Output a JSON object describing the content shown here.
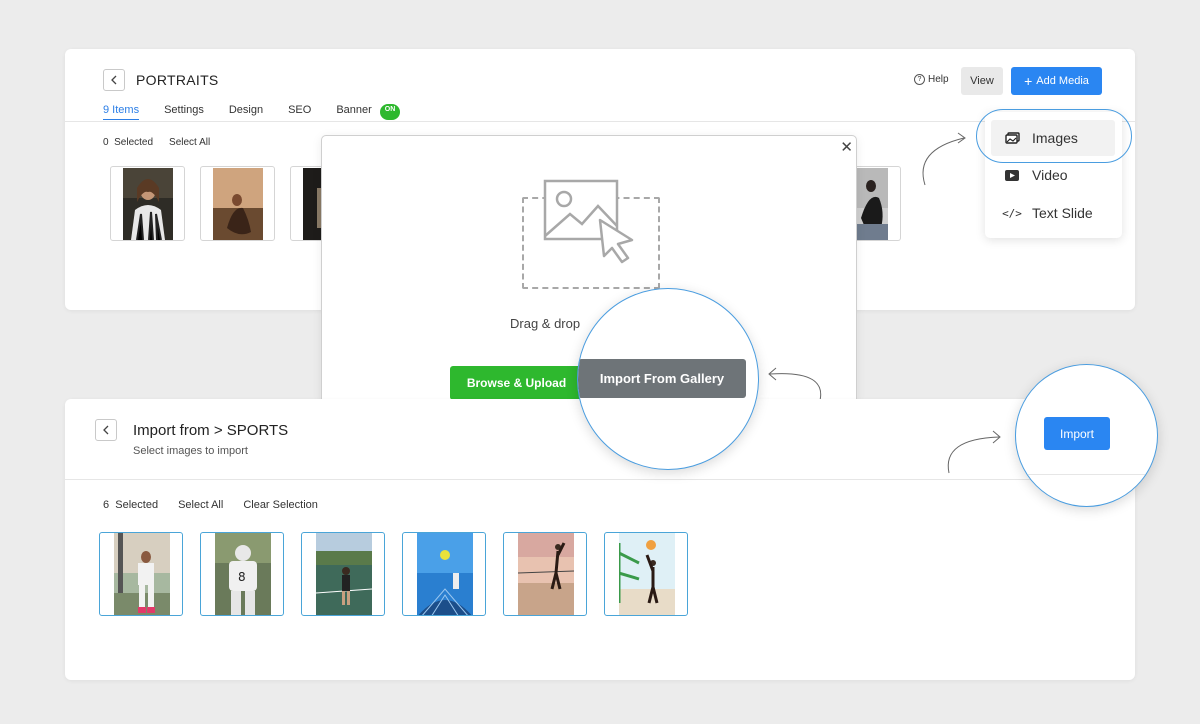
{
  "portraits": {
    "title": "PORTRAITS",
    "tabs": [
      "9 Items",
      "Settings",
      "Design",
      "SEO",
      "Banner"
    ],
    "banner_badge": "ON",
    "help": "Help",
    "view": "View",
    "add_media": "Add Media",
    "selected_count": "0",
    "selected_label": "Selected",
    "select_all": "Select All"
  },
  "add_media_menu": {
    "items": [
      "Images",
      "Video",
      "Text Slide"
    ]
  },
  "upload_modal": {
    "drag_text": "Drag & drop",
    "browse": "Browse & Upload",
    "import_gallery": "Import From Gallery"
  },
  "import_panel": {
    "title": "Import from > SPORTS",
    "subtitle": "Select images to import",
    "selected_count": "6",
    "selected_label": "Selected",
    "select_all": "Select All",
    "clear": "Clear Selection",
    "import": "Import"
  },
  "colors": {
    "accent_blue": "#2a86f2",
    "success_green": "#2eb82e",
    "gallery_gray": "#6e7478",
    "callout_ring": "#4a9de0"
  }
}
